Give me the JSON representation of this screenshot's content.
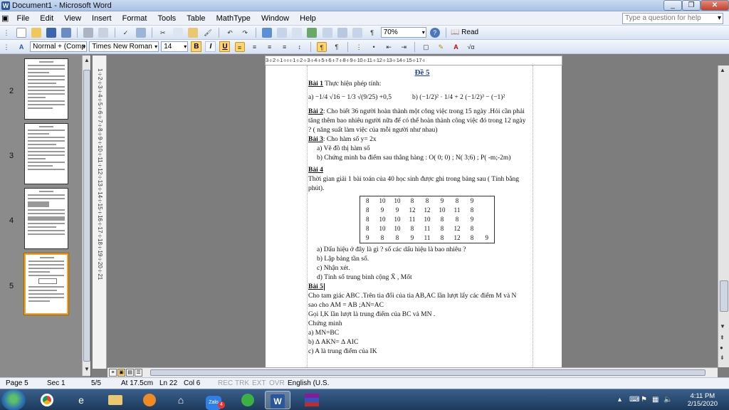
{
  "window": {
    "title": "Document1 - Microsoft Word",
    "minimize": "_",
    "restore": "❐",
    "close": "✕"
  },
  "menu": {
    "items": [
      "File",
      "Edit",
      "View",
      "Insert",
      "Format",
      "Tools",
      "Table",
      "MathType",
      "Window",
      "Help"
    ],
    "help_placeholder": "Type a question for help"
  },
  "toolbar": {
    "zoom": "70%",
    "read_label": "Read",
    "style": "Normal + (Comp",
    "font": "Times New Roman",
    "size": "14",
    "bold": "B",
    "italic": "I",
    "underline": "U"
  },
  "thumbnails": [
    {
      "num": "2"
    },
    {
      "num": "3"
    },
    {
      "num": "4"
    },
    {
      "num": "5"
    }
  ],
  "ruler": {
    "horizontal": "3·ı·2·ı·1·ı·ı·ı·1·ı·2·ı·3·ı·4·ı·5·ı·6·ı·7·ı·8·ı·9·ı·10·ı·11·ı·12·ı·13·ı·14·ı·15·ı·17·ı",
    "vertical": "1·ı·2·ı·3·ı·4·ı·5·ı·6·ı·7·ı·8·ı·9·ı·10·ı·11·ı·12·ı·13·ı·14·ı·15·ı·16·ı·17·ı·18·ı·19·ı·20·ı·21"
  },
  "doc": {
    "title": "Đề 5",
    "bai1_head": "Bài 1",
    "bai1_text": " Thực hiện phép tính:",
    "bai1_a": "a) −1/4 √16 − 1/3 √(9/25) +0,5",
    "bai1_b": "b)  (−1/2)² · 1/4 + 2 (−1/2)³ − (−1)²",
    "bai2_head": "Bài 2",
    "bai2_l1": ": Cho biết 36 người hoàn thành một công việc trong 15 ngày .Hỏi cần phải",
    "bai2_l2": "tăng thêm bao nhiêu người nữa để có thể hoàn thành công việc đó trong 12 ngày",
    "bai2_l3": "? ( năng suất làm việc của mỗi người như nhau)",
    "bai3_head": "Bài 3",
    "bai3_text": ": Cho hàm số    y= 2x",
    "bai3_a": "a)  Vẽ đồ thị hàm số",
    "bai3_b": "b)  Chứng minh ba điểm sau thẳng hàng :  O( 0; 0)  ; N( 3;6)  ; P(  -m;-2m)",
    "bai4_head": "Bài 4",
    "bai4_l1": "Thời gian giải 1 bài toán của 40 học sinh được ghi trong bảng sau ( Tính bằng",
    "bai4_l2": "phút).",
    "table": [
      [
        "8",
        "10",
        "10",
        "8",
        "8",
        "9",
        "8",
        "9"
      ],
      [
        "8",
        "9",
        "9",
        "12",
        "12",
        "10",
        "11",
        "8"
      ],
      [
        "8",
        "10",
        "10",
        "11",
        "10",
        "8",
        "8",
        "9"
      ],
      [
        "8",
        "10",
        "10",
        "8",
        "11",
        "8",
        "12",
        "8"
      ],
      [
        "9",
        "8",
        "8",
        "9",
        "11",
        "8",
        "12",
        "8",
        "9"
      ]
    ],
    "bai4_a": "a)  Dấu hiệu ở đây là gì ? số các dấu hiệu là bao nhiêu ?",
    "bai4_b": "b)  Lập bảng tần số.",
    "bai4_c": "c)  Nhận xét.",
    "bai4_d": "d)  Tính số trung bình cộng X̄ , Mốt",
    "bai5_head": "Bài 5",
    "bai5_l1": "Cho tam giác ABC .Trên tia đối của tia AB,AC lần lượt lấy các điểm M và N",
    "bai5_l2": "sao cho AM = AB ;AN=AC",
    "bai5_l3": "Gọi I,K lần lượt là trung điểm của BC và MN .",
    "bai5_l4": "Chứng minh",
    "bai5_a": "a) MN=BC",
    "bai5_b": "b) ∆ AKN= ∆ AIC",
    "bai5_c": "c) A là trung điểm của IK"
  },
  "status": {
    "page": "Page 5",
    "sec": "Sec 1",
    "pages": "5/5",
    "at": "At 17.5cm",
    "ln": "Ln 22",
    "col": "Col 6",
    "rec": "REC",
    "trk": "TRK",
    "ext": "EXT",
    "ovr": "OVR",
    "lang": "English (U.S."
  },
  "taskbar": {
    "time": "4:11 PM",
    "date": "2/15/2020",
    "zalo_badge": "4"
  }
}
